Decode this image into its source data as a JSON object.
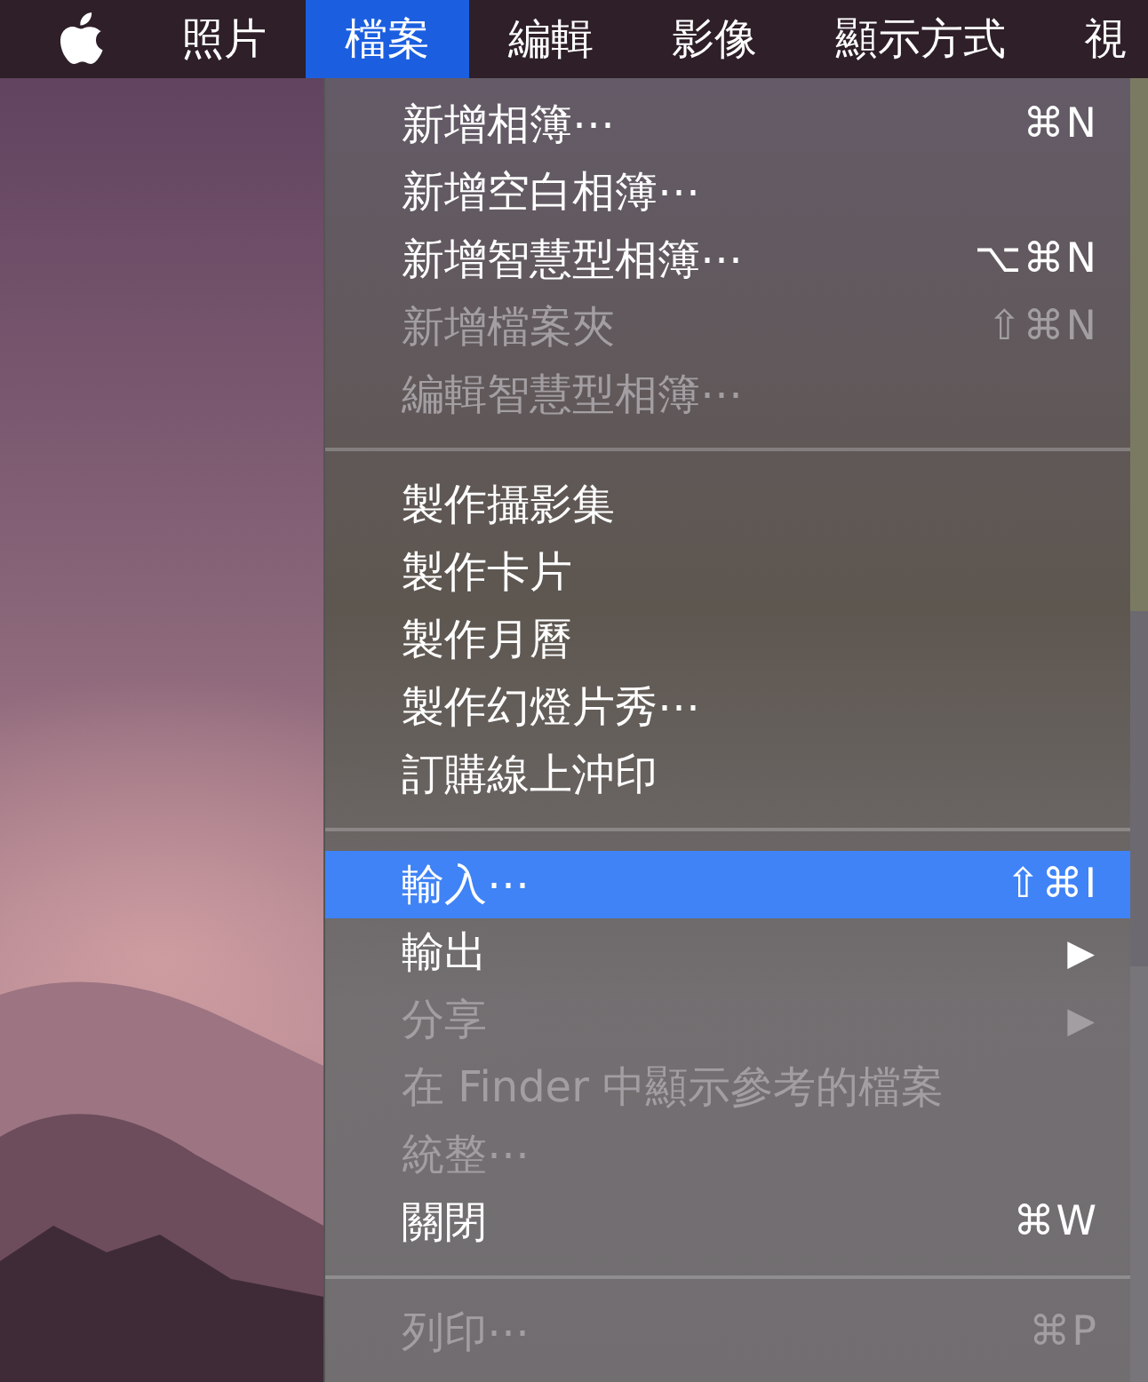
{
  "menubar": {
    "items": [
      {
        "label": "照片",
        "selected": false
      },
      {
        "label": "檔案",
        "selected": true
      },
      {
        "label": "編輯",
        "selected": false
      },
      {
        "label": "影像",
        "selected": false
      },
      {
        "label": "顯示方式",
        "selected": false
      },
      {
        "label": "視",
        "selected": false
      }
    ]
  },
  "menu": {
    "sections": [
      {
        "items": [
          {
            "label": "新增相簿⋯",
            "shortcut": "⌘N",
            "disabled": false,
            "selected": false
          },
          {
            "label": "新增空白相簿⋯",
            "disabled": false,
            "selected": false
          },
          {
            "label": "新增智慧型相簿⋯",
            "shortcut": "⌥⌘N",
            "disabled": false,
            "selected": false
          },
          {
            "label": "新增檔案夾",
            "shortcut": "⇧⌘N",
            "disabled": true,
            "selected": false
          },
          {
            "label": "編輯智慧型相簿⋯",
            "disabled": true,
            "selected": false
          }
        ]
      },
      {
        "items": [
          {
            "label": "製作攝影集",
            "disabled": false,
            "selected": false
          },
          {
            "label": "製作卡片",
            "disabled": false,
            "selected": false
          },
          {
            "label": "製作月曆",
            "disabled": false,
            "selected": false
          },
          {
            "label": "製作幻燈片秀⋯",
            "disabled": false,
            "selected": false
          },
          {
            "label": "訂購線上沖印",
            "disabled": false,
            "selected": false
          }
        ]
      },
      {
        "items": [
          {
            "label": "輸入⋯",
            "shortcut": "⇧⌘I",
            "disabled": false,
            "selected": true
          },
          {
            "label": "輸出",
            "submenu_arrow": "▶",
            "disabled": false,
            "selected": false
          },
          {
            "label": "分享",
            "submenu_arrow": "▶",
            "disabled": true,
            "selected": false
          },
          {
            "label": "在 Finder 中顯示參考的檔案",
            "disabled": true,
            "selected": false
          },
          {
            "label": "統整⋯",
            "disabled": true,
            "selected": false
          },
          {
            "label": "關閉",
            "shortcut": "⌘W",
            "disabled": false,
            "selected": false
          }
        ]
      },
      {
        "items": [
          {
            "label": "列印⋯",
            "shortcut": "⌘P",
            "disabled": true,
            "selected": false
          }
        ]
      }
    ]
  }
}
